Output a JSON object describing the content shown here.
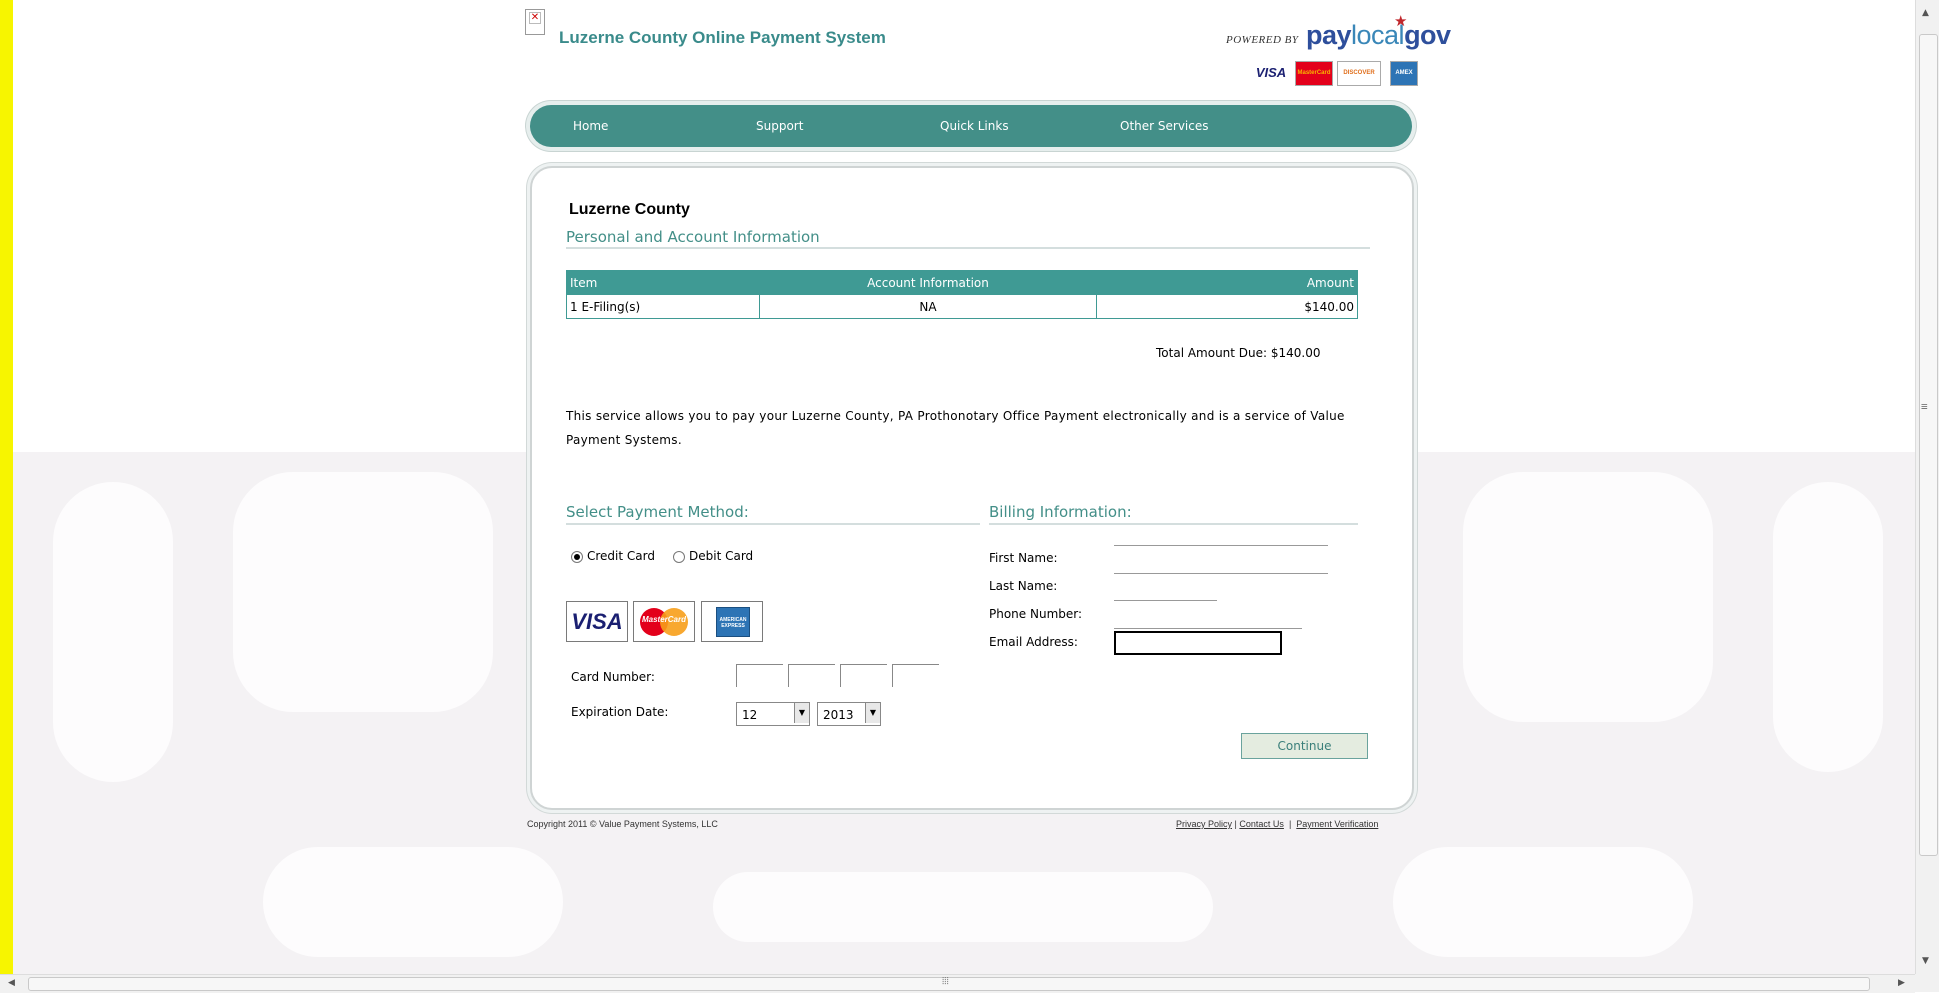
{
  "header": {
    "title": "Luzerne County Online Payment System",
    "powered_by": "POWERED BY",
    "brand_pay": "pay",
    "brand_local": "local",
    "brand_gov": "gov",
    "accepted_cards": [
      "VISA",
      "MasterCard",
      "DISCOVER",
      "AMEX"
    ]
  },
  "nav": {
    "items": [
      "Home",
      "Support",
      "Quick Links",
      "Other Services"
    ]
  },
  "main": {
    "heading": "Luzerne County",
    "subheading": "Personal and Account Information",
    "table": {
      "headers": [
        "Item",
        "Account Information",
        "Amount"
      ],
      "rows": [
        [
          "1 E-Filing(s)",
          "NA",
          "$140.00"
        ]
      ]
    },
    "total_due": "Total Amount Due: $140.00",
    "description": "This service allows you to pay your Luzerne County, PA Prothonotary Office Payment electronically and is a service of Value Payment Systems."
  },
  "payment": {
    "heading": "Select Payment Method:",
    "options": [
      "Credit Card",
      "Debit Card"
    ],
    "selected": "Credit Card",
    "card_logos": [
      "VISA",
      "MasterCard",
      "American Express"
    ],
    "mastercard_text": "MasterCard",
    "amex_text": "AMERICAN EXPRESS",
    "card_number_label": "Card Number:",
    "expiration_label": "Expiration Date:",
    "exp_month": "12",
    "exp_year": "2013"
  },
  "billing": {
    "heading": "Billing Information:",
    "first_name_label": "First Name:",
    "last_name_label": "Last Name:",
    "phone_label": "Phone Number:",
    "email_label": "Email Address:"
  },
  "actions": {
    "continue_label": "Continue"
  },
  "footer": {
    "copyright": "Copyright 2011 © Value Payment Systems, LLC",
    "links": [
      "Privacy Policy",
      "Contact Us",
      "Payment Verification"
    ],
    "separator": "|"
  },
  "colors": {
    "accent": "#438f88",
    "title": "#3a8b8b",
    "page_left_bar": "#f7f500"
  }
}
